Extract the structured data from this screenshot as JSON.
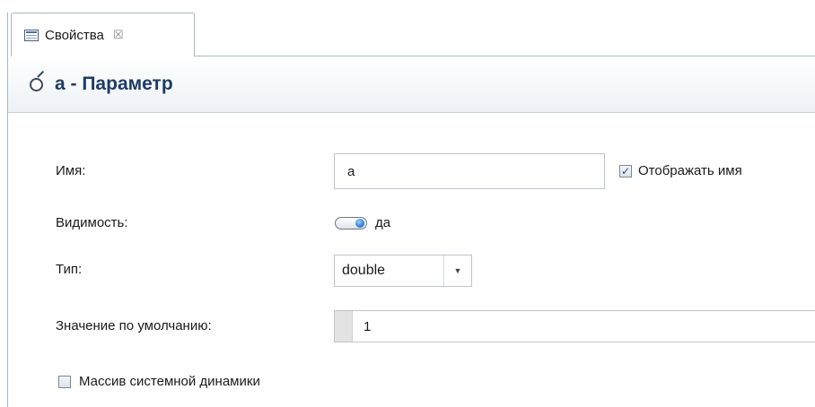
{
  "tab": {
    "icon": "properties-table-icon",
    "label": "Свойства",
    "close_glyph": "☒"
  },
  "header": {
    "icon": "parameter-icon",
    "title": "a - Параметр"
  },
  "form": {
    "name_label": "Имя:",
    "name_value": "a",
    "show_name_label": "Отображать имя",
    "show_name_checked": true,
    "visibility_label": "Видимость:",
    "visibility_value": "да",
    "type_label": "Тип:",
    "type_value": "double",
    "default_label": "Значение по умолчанию:",
    "default_value": "1",
    "sysdyn_array_label": "Массив системной динамики",
    "sysdyn_array_checked": false
  },
  "colors": {
    "title": "#1f3b66",
    "border": "#a9b6c7",
    "toggle_knob": "#1f6fd1"
  }
}
